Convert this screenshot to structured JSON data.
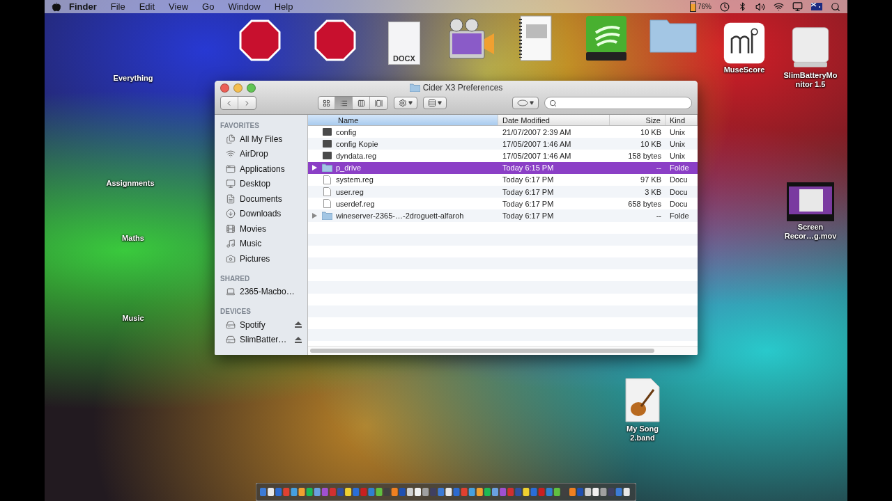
{
  "menubar": {
    "menus": [
      "Finder",
      "File",
      "Edit",
      "View",
      "Go",
      "Window",
      "Help"
    ],
    "battery": "76%"
  },
  "desktop_icons": [
    {
      "kind": "none",
      "label": "Everything"
    },
    {
      "kind": "stop"
    },
    {
      "kind": "stop"
    },
    {
      "kind": "docx",
      "text": "DOCX"
    },
    {
      "kind": "movie"
    },
    {
      "kind": "notebook"
    },
    {
      "kind": "green-drive"
    },
    {
      "kind": "folder"
    },
    {
      "kind": "musescore",
      "label": "MuseScore"
    },
    {
      "kind": "white-drive",
      "label": "SlimBatteryMonitor 1.5"
    },
    {
      "kind": "none",
      "label": "Assignments"
    },
    {
      "kind": "none",
      "label": "Maths"
    },
    {
      "kind": "video",
      "label": "Screen Recor…g.mov"
    },
    {
      "kind": "none",
      "label": "Music"
    },
    {
      "kind": "guitar",
      "label": "My Song 2.band"
    }
  ],
  "window": {
    "title": "Cider X3 Preferences",
    "view_buttons": [
      {
        "selected": false
      },
      {
        "selected": true
      },
      {
        "selected": false
      },
      {
        "selected": false
      }
    ],
    "sidebar": [
      {
        "heading": "FAVORITES",
        "items": [
          {
            "label": "All My Files",
            "kind": "files"
          },
          {
            "label": "AirDrop",
            "kind": "airdrop"
          },
          {
            "label": "Applications",
            "kind": "apps"
          },
          {
            "label": "Desktop",
            "kind": "desktop"
          },
          {
            "label": "Documents",
            "kind": "documents"
          },
          {
            "label": "Downloads",
            "kind": "downloads"
          },
          {
            "label": "Movies",
            "kind": "movies"
          },
          {
            "label": "Music",
            "kind": "music"
          },
          {
            "label": "Pictures",
            "kind": "pictures"
          }
        ]
      },
      {
        "heading": "SHARED",
        "items": [
          {
            "label": "2365-Macbo…",
            "kind": "computer"
          }
        ]
      },
      {
        "heading": "DEVICES",
        "items": [
          {
            "label": "Spotify",
            "kind": "disk",
            "eject": true
          },
          {
            "label": "SlimBatter…",
            "kind": "disk",
            "eject": true
          }
        ]
      }
    ],
    "columns": [
      "Name",
      "Date Modified",
      "Size",
      "Kind"
    ],
    "rows": [
      {
        "name": "config",
        "date": "21/07/2007 2:39 AM",
        "size": "10 KB",
        "file_kind": "Unix",
        "kind": "exec",
        "expandable": false,
        "selected": false
      },
      {
        "name": "config Kopie",
        "date": "17/05/2007 1:46 AM",
        "size": "10 KB",
        "file_kind": "Unix",
        "kind": "exec",
        "expandable": false,
        "selected": false
      },
      {
        "name": "dyndata.reg",
        "date": "17/05/2007 1:46 AM",
        "size": "158 bytes",
        "file_kind": "Unix",
        "kind": "exec",
        "expandable": false,
        "selected": false
      },
      {
        "name": "p_drive",
        "date": "Today 6:15 PM",
        "size": "--",
        "file_kind": "Folde",
        "kind": "folder",
        "expandable": true,
        "selected": true
      },
      {
        "name": "system.reg",
        "date": "Today 6:17 PM",
        "size": "97 KB",
        "file_kind": "Docu",
        "kind": "doc",
        "expandable": false,
        "selected": false
      },
      {
        "name": "user.reg",
        "date": "Today 6:17 PM",
        "size": "3 KB",
        "file_kind": "Docu",
        "kind": "doc",
        "expandable": false,
        "selected": false
      },
      {
        "name": "userdef.reg",
        "date": "Today 6:17 PM",
        "size": "658 bytes",
        "file_kind": "Docu",
        "kind": "doc",
        "expandable": false,
        "selected": false
      },
      {
        "name": "wineserver-2365-…-2droguett-alfaroh",
        "date": "Today 6:17 PM",
        "size": "--",
        "file_kind": "Folde",
        "kind": "folder",
        "expandable": true,
        "selected": false
      }
    ]
  }
}
